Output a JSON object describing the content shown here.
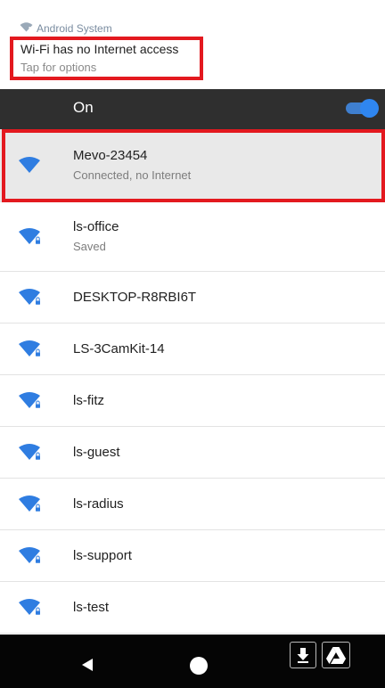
{
  "notification": {
    "source": "Android System",
    "title": "Wi-Fi has no Internet access",
    "subtitle": "Tap for options",
    "source_icon": "wifi-alert-icon"
  },
  "wifi_toggle": {
    "label": "On",
    "state": "on"
  },
  "networks": [
    {
      "name": "Mevo-23454",
      "status": "Connected, no Internet",
      "icon": "wifi-icon",
      "locked": false,
      "selected": true
    },
    {
      "name": "ls-office",
      "status": "Saved",
      "icon": "wifi-lock-icon",
      "locked": true,
      "selected": false
    },
    {
      "name": "DESKTOP-R8RBI6T",
      "status": "",
      "icon": "wifi-lock-icon",
      "locked": true,
      "selected": false
    },
    {
      "name": "LS-3CamKit-14",
      "status": "",
      "icon": "wifi-lock-icon",
      "locked": true,
      "selected": false
    },
    {
      "name": "ls-fitz",
      "status": "",
      "icon": "wifi-lock-icon",
      "locked": true,
      "selected": false
    },
    {
      "name": "ls-guest",
      "status": "",
      "icon": "wifi-lock-icon",
      "locked": true,
      "selected": false
    },
    {
      "name": "ls-radius",
      "status": "",
      "icon": "wifi-lock-icon",
      "locked": true,
      "selected": false
    },
    {
      "name": "ls-support",
      "status": "",
      "icon": "wifi-lock-icon",
      "locked": true,
      "selected": false
    },
    {
      "name": "ls-test",
      "status": "",
      "icon": "wifi-lock-icon",
      "locked": true,
      "selected": false
    }
  ],
  "nav_bar": {
    "icons": [
      "back-icon",
      "home-icon",
      "download-icon",
      "drive-icon"
    ]
  },
  "colors": {
    "accent": "#2f86f0",
    "wifi_icon": "#2f7de1",
    "highlight_border": "#e3191f",
    "on_bar": "#2f2f2f",
    "selected_row": "#e9e9e9"
  }
}
